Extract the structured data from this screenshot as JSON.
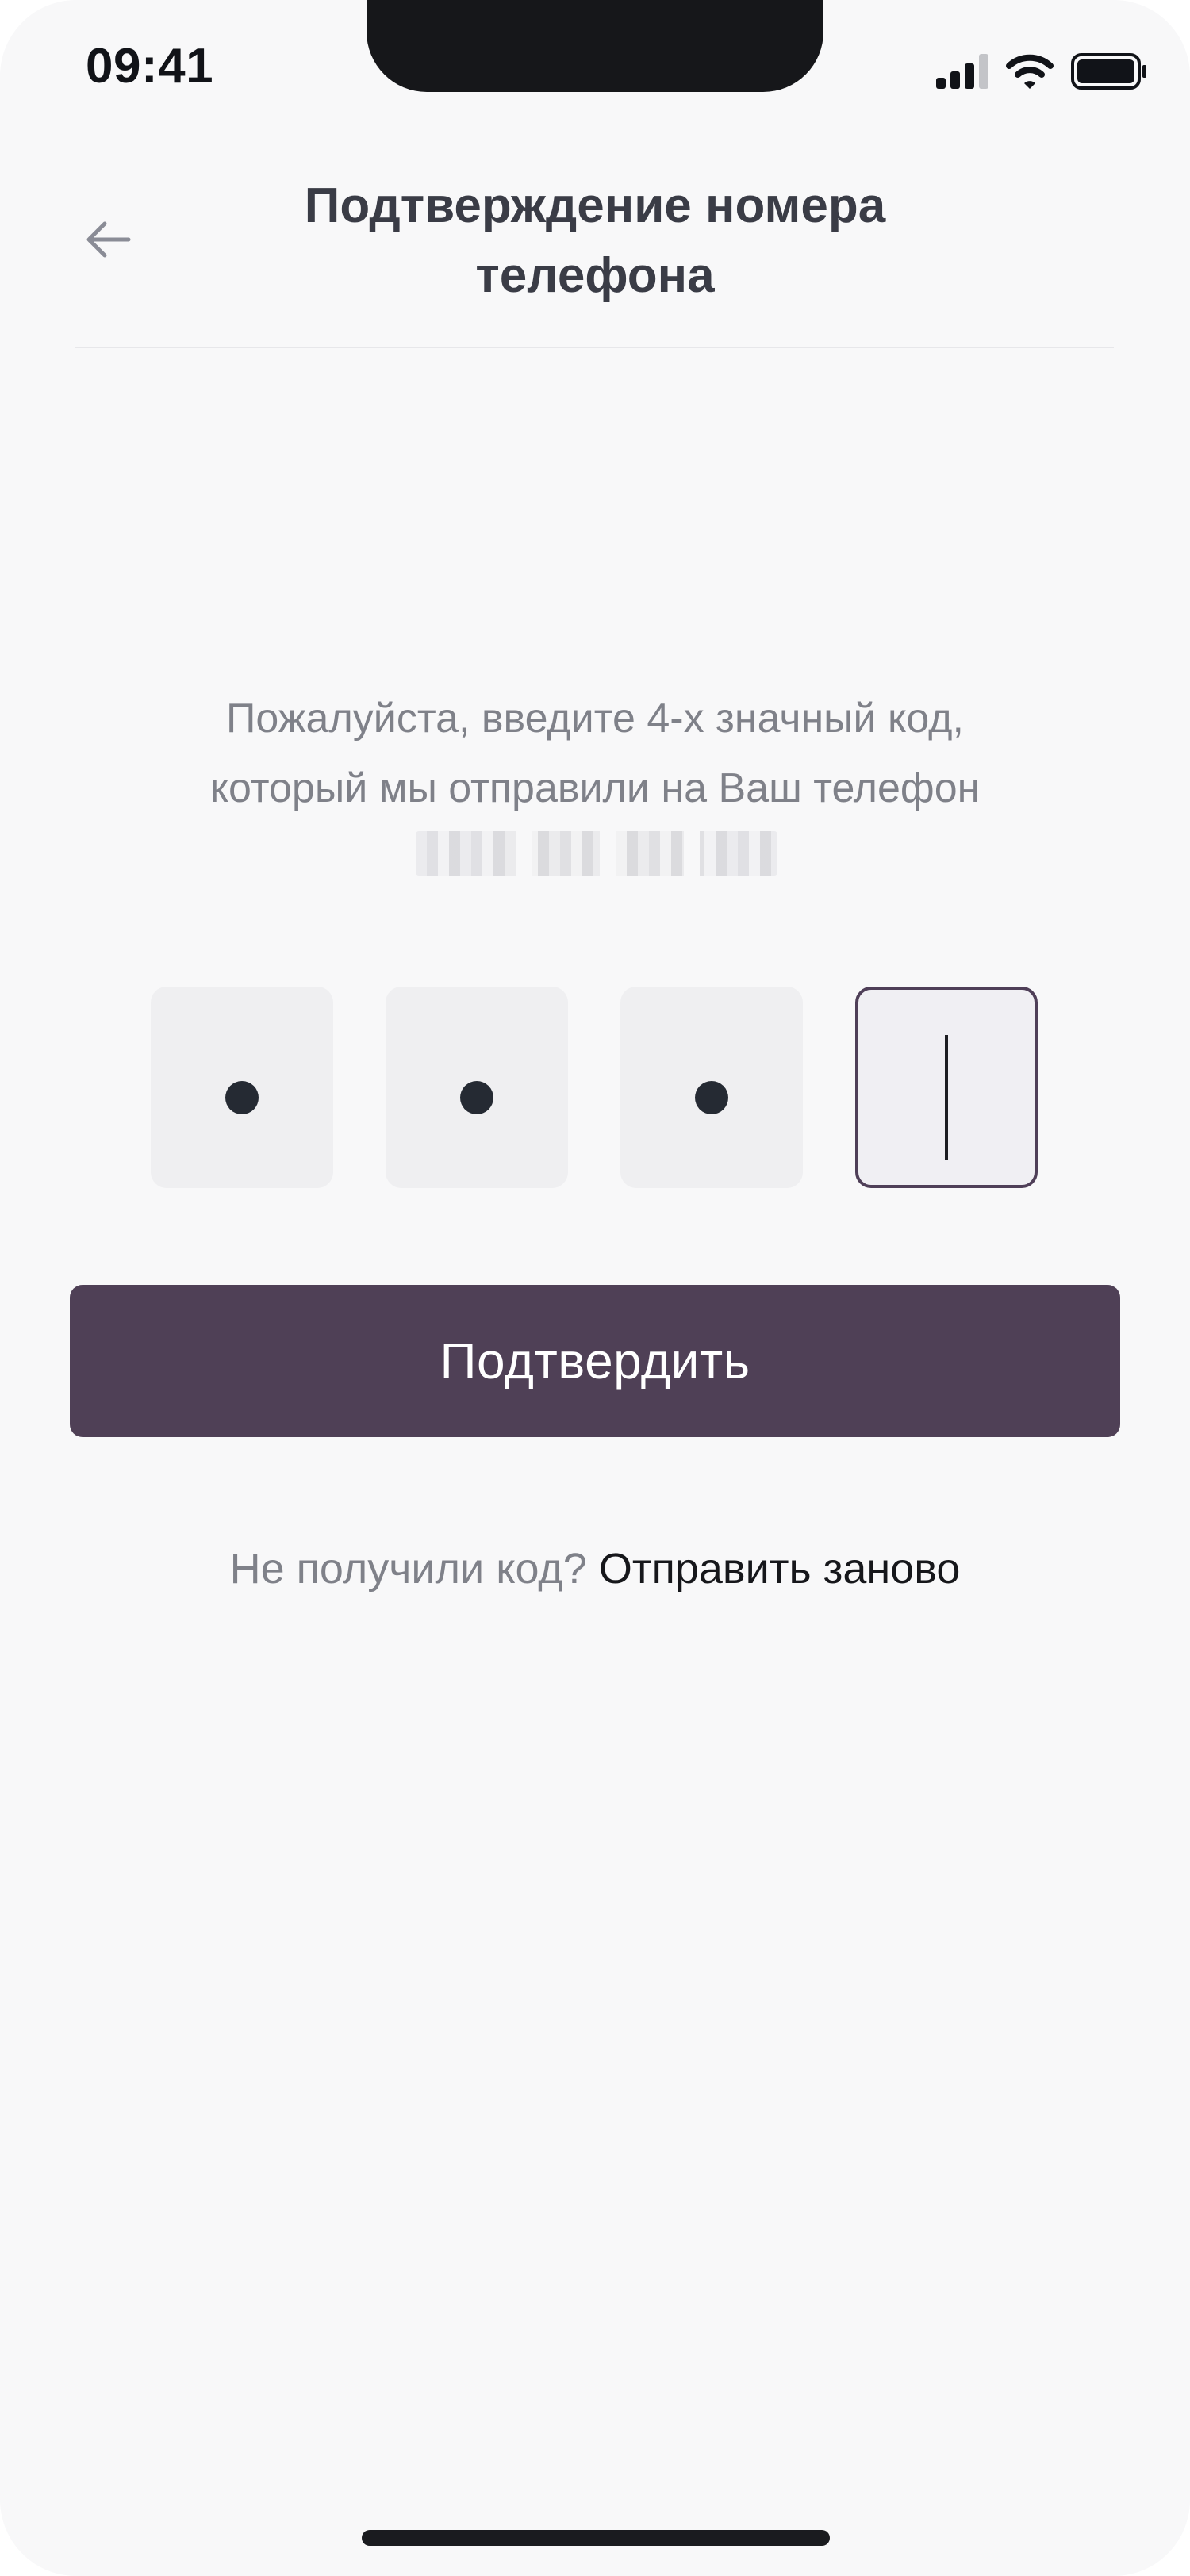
{
  "status_bar": {
    "time": "09:41",
    "icons": [
      "cellular-signal-icon",
      "wifi-icon",
      "battery-icon"
    ]
  },
  "header": {
    "back_icon": "arrow-left-icon",
    "title": "Подтверждение номера телефона"
  },
  "instruction": {
    "line1": "Пожалуйста, введите 4-х значный код,",
    "line2": "который мы отправили на Ваш телефон"
  },
  "otp": {
    "length": 4,
    "filled": 3,
    "mask_char": "•"
  },
  "confirm_button": {
    "label": "Подтвердить"
  },
  "resend": {
    "prompt": "Не получили код?",
    "link": "Отправить заново"
  },
  "colors": {
    "primary": "#4f4056",
    "background": "#f8f8f9",
    "muted_text": "#7f8189",
    "title_text": "#3a3c46"
  }
}
